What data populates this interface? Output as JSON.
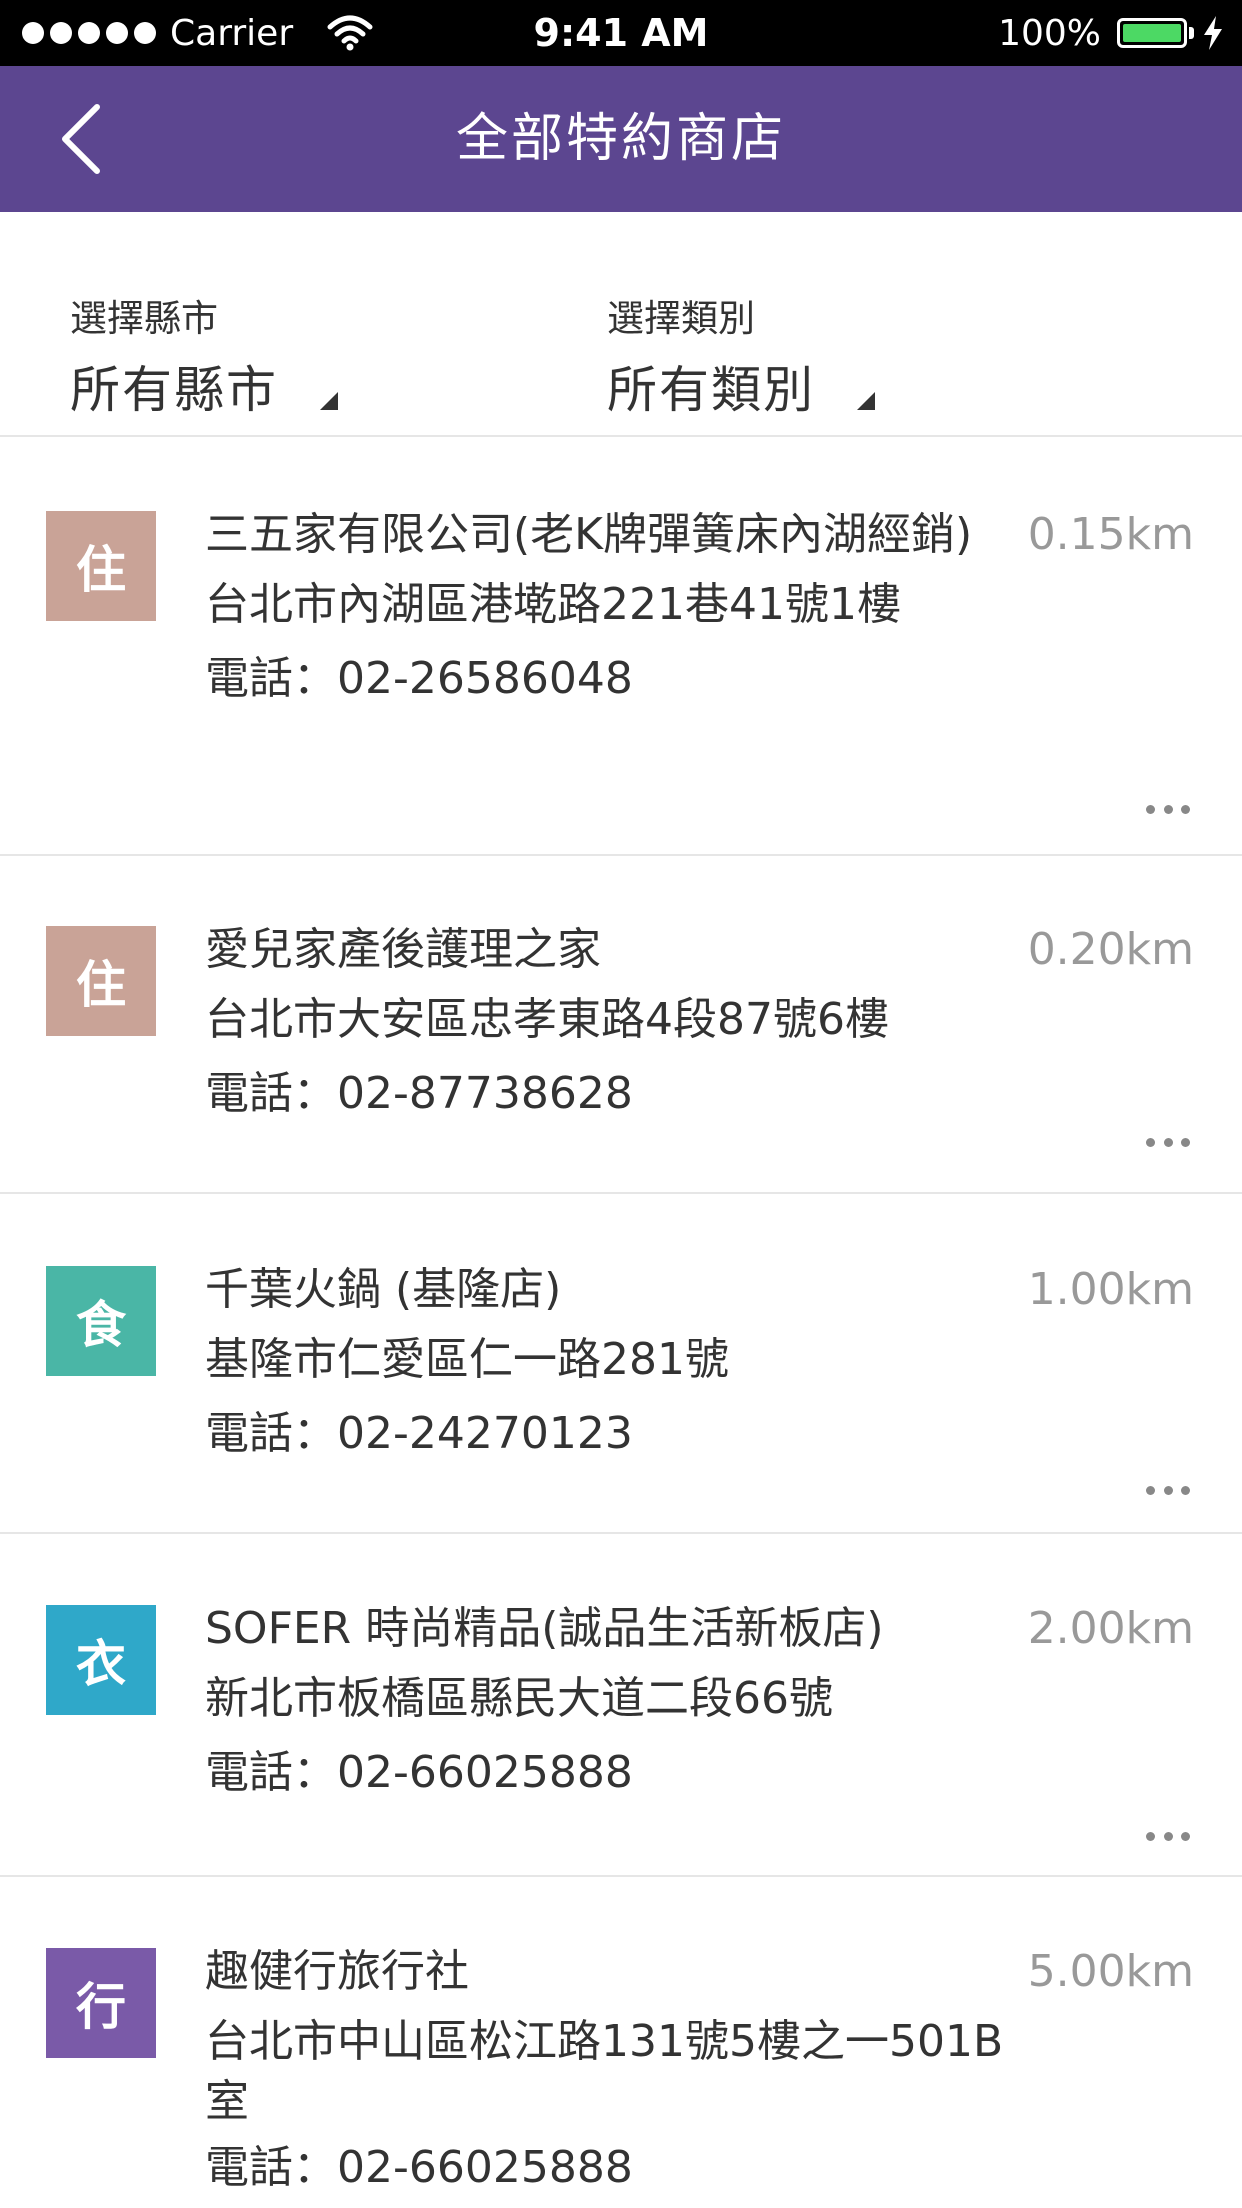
{
  "status_bar": {
    "carrier": "Carrier",
    "time": "9:41 AM",
    "battery": "100%",
    "signal_icon": "signal-dots-icon",
    "wifi_icon": "wifi-icon",
    "battery_icon": "battery-icon",
    "charging_icon": "charging-bolt-icon"
  },
  "nav": {
    "back_icon": "chevron-left-icon",
    "title": "全部特約商店"
  },
  "filters": {
    "city": {
      "label": "選擇縣市",
      "value": "所有縣市"
    },
    "category": {
      "label": "選擇類別",
      "value": "所有類別"
    }
  },
  "colors": {
    "nav_bg": "#5c4690",
    "badge_live": "#c9a397",
    "badge_food": "#4ab6a6",
    "badge_clothing": "#2fa8c9",
    "badge_travel": "#7a5aa8",
    "distance_text": "#999999"
  },
  "stores": [
    {
      "category": "住",
      "name": "三五家有限公司(老K牌彈簧床內湖經銷)",
      "address": "台北市內湖區港墘路221巷41號1樓",
      "phone": "電話：02-26586048",
      "distance": "0.15km"
    },
    {
      "category": "住",
      "name": "愛兒家產後護理之家",
      "address": "台北市大安區忠孝東路4段87號6樓",
      "phone": "電話：02-87738628",
      "distance": "0.20km"
    },
    {
      "category": "食",
      "name": "千葉火鍋 (基隆店)",
      "address": "基隆市仁愛區仁一路281號",
      "phone": "電話：02-24270123",
      "distance": "1.00km"
    },
    {
      "category": "衣",
      "name": "SOFER 時尚精品(誠品生活新板店)",
      "address": "新北市板橋區縣民大道二段66號",
      "phone": "電話：02-66025888",
      "distance": "2.00km"
    },
    {
      "category": "行",
      "name": "趣健行旅行社",
      "address": "台北市中山區松江路131號5樓之一501B室",
      "phone": "電話：02-66025888",
      "distance": "5.00km"
    }
  ]
}
